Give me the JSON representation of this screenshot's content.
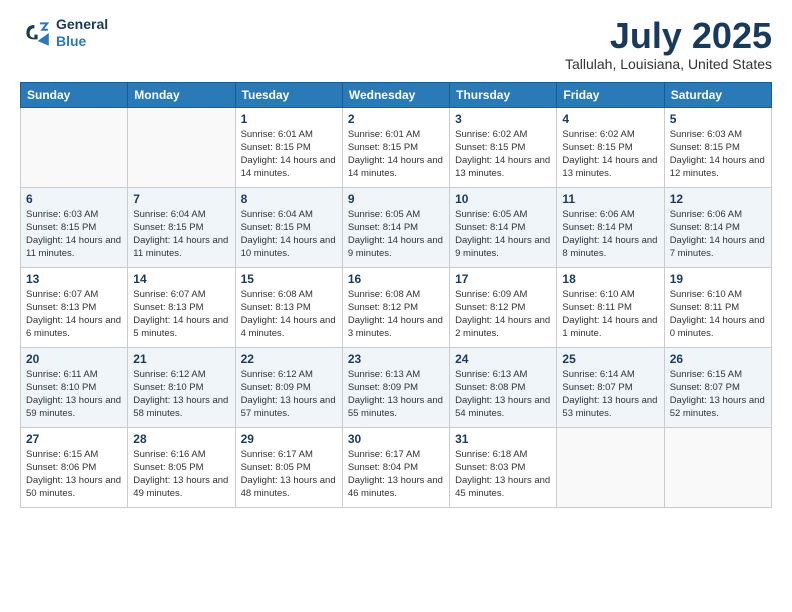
{
  "logo": {
    "line1": "General",
    "line2": "Blue"
  },
  "title": "July 2025",
  "location": "Tallulah, Louisiana, United States",
  "days_of_week": [
    "Sunday",
    "Monday",
    "Tuesday",
    "Wednesday",
    "Thursday",
    "Friday",
    "Saturday"
  ],
  "weeks": [
    [
      {
        "day": "",
        "info": ""
      },
      {
        "day": "",
        "info": ""
      },
      {
        "day": "1",
        "info": "Sunrise: 6:01 AM\nSunset: 8:15 PM\nDaylight: 14 hours and 14 minutes."
      },
      {
        "day": "2",
        "info": "Sunrise: 6:01 AM\nSunset: 8:15 PM\nDaylight: 14 hours and 14 minutes."
      },
      {
        "day": "3",
        "info": "Sunrise: 6:02 AM\nSunset: 8:15 PM\nDaylight: 14 hours and 13 minutes."
      },
      {
        "day": "4",
        "info": "Sunrise: 6:02 AM\nSunset: 8:15 PM\nDaylight: 14 hours and 13 minutes."
      },
      {
        "day": "5",
        "info": "Sunrise: 6:03 AM\nSunset: 8:15 PM\nDaylight: 14 hours and 12 minutes."
      }
    ],
    [
      {
        "day": "6",
        "info": "Sunrise: 6:03 AM\nSunset: 8:15 PM\nDaylight: 14 hours and 11 minutes."
      },
      {
        "day": "7",
        "info": "Sunrise: 6:04 AM\nSunset: 8:15 PM\nDaylight: 14 hours and 11 minutes."
      },
      {
        "day": "8",
        "info": "Sunrise: 6:04 AM\nSunset: 8:15 PM\nDaylight: 14 hours and 10 minutes."
      },
      {
        "day": "9",
        "info": "Sunrise: 6:05 AM\nSunset: 8:14 PM\nDaylight: 14 hours and 9 minutes."
      },
      {
        "day": "10",
        "info": "Sunrise: 6:05 AM\nSunset: 8:14 PM\nDaylight: 14 hours and 9 minutes."
      },
      {
        "day": "11",
        "info": "Sunrise: 6:06 AM\nSunset: 8:14 PM\nDaylight: 14 hours and 8 minutes."
      },
      {
        "day": "12",
        "info": "Sunrise: 6:06 AM\nSunset: 8:14 PM\nDaylight: 14 hours and 7 minutes."
      }
    ],
    [
      {
        "day": "13",
        "info": "Sunrise: 6:07 AM\nSunset: 8:13 PM\nDaylight: 14 hours and 6 minutes."
      },
      {
        "day": "14",
        "info": "Sunrise: 6:07 AM\nSunset: 8:13 PM\nDaylight: 14 hours and 5 minutes."
      },
      {
        "day": "15",
        "info": "Sunrise: 6:08 AM\nSunset: 8:13 PM\nDaylight: 14 hours and 4 minutes."
      },
      {
        "day": "16",
        "info": "Sunrise: 6:08 AM\nSunset: 8:12 PM\nDaylight: 14 hours and 3 minutes."
      },
      {
        "day": "17",
        "info": "Sunrise: 6:09 AM\nSunset: 8:12 PM\nDaylight: 14 hours and 2 minutes."
      },
      {
        "day": "18",
        "info": "Sunrise: 6:10 AM\nSunset: 8:11 PM\nDaylight: 14 hours and 1 minute."
      },
      {
        "day": "19",
        "info": "Sunrise: 6:10 AM\nSunset: 8:11 PM\nDaylight: 14 hours and 0 minutes."
      }
    ],
    [
      {
        "day": "20",
        "info": "Sunrise: 6:11 AM\nSunset: 8:10 PM\nDaylight: 13 hours and 59 minutes."
      },
      {
        "day": "21",
        "info": "Sunrise: 6:12 AM\nSunset: 8:10 PM\nDaylight: 13 hours and 58 minutes."
      },
      {
        "day": "22",
        "info": "Sunrise: 6:12 AM\nSunset: 8:09 PM\nDaylight: 13 hours and 57 minutes."
      },
      {
        "day": "23",
        "info": "Sunrise: 6:13 AM\nSunset: 8:09 PM\nDaylight: 13 hours and 55 minutes."
      },
      {
        "day": "24",
        "info": "Sunrise: 6:13 AM\nSunset: 8:08 PM\nDaylight: 13 hours and 54 minutes."
      },
      {
        "day": "25",
        "info": "Sunrise: 6:14 AM\nSunset: 8:07 PM\nDaylight: 13 hours and 53 minutes."
      },
      {
        "day": "26",
        "info": "Sunrise: 6:15 AM\nSunset: 8:07 PM\nDaylight: 13 hours and 52 minutes."
      }
    ],
    [
      {
        "day": "27",
        "info": "Sunrise: 6:15 AM\nSunset: 8:06 PM\nDaylight: 13 hours and 50 minutes."
      },
      {
        "day": "28",
        "info": "Sunrise: 6:16 AM\nSunset: 8:05 PM\nDaylight: 13 hours and 49 minutes."
      },
      {
        "day": "29",
        "info": "Sunrise: 6:17 AM\nSunset: 8:05 PM\nDaylight: 13 hours and 48 minutes."
      },
      {
        "day": "30",
        "info": "Sunrise: 6:17 AM\nSunset: 8:04 PM\nDaylight: 13 hours and 46 minutes."
      },
      {
        "day": "31",
        "info": "Sunrise: 6:18 AM\nSunset: 8:03 PM\nDaylight: 13 hours and 45 minutes."
      },
      {
        "day": "",
        "info": ""
      },
      {
        "day": "",
        "info": ""
      }
    ]
  ]
}
